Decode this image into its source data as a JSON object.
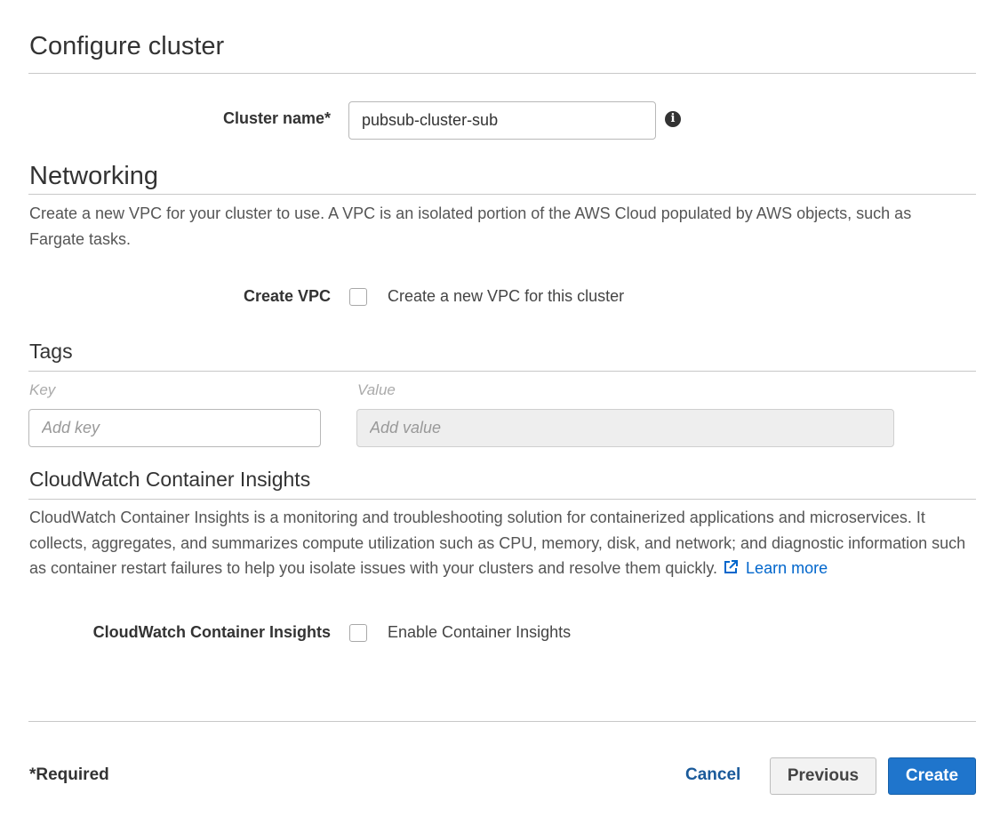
{
  "configure": {
    "title": "Configure cluster"
  },
  "cluster_name": {
    "label": "Cluster name*",
    "value": "pubsub-cluster-sub",
    "info_icon": "info-icon"
  },
  "networking": {
    "title": "Networking",
    "description": "Create a new VPC for your cluster to use. A VPC is an isolated portion of the AWS Cloud populated by AWS objects, such as Fargate tasks.",
    "create_vpc_label": "Create VPC",
    "create_vpc_checkbox_text": "Create a new VPC for this cluster",
    "create_vpc_checked": false
  },
  "tags": {
    "title": "Tags",
    "key_header": "Key",
    "value_header": "Value",
    "key_placeholder": "Add key",
    "value_placeholder": "Add value"
  },
  "insights": {
    "title": "CloudWatch Container Insights",
    "description": "CloudWatch Container Insights is a monitoring and troubleshooting solution for containerized applications and microservices. It collects, aggregates, and summarizes compute utilization such as CPU, memory, disk, and network; and diagnostic information such as container restart failures to help you isolate issues with your clusters and resolve them quickly.",
    "learn_more": "Learn more",
    "learn_more_icon": "external-link-icon",
    "field_label": "CloudWatch Container Insights",
    "checkbox_text": "Enable Container Insights",
    "checked": false
  },
  "footer": {
    "required_note": "*Required",
    "cancel": "Cancel",
    "previous": "Previous",
    "create": "Create"
  },
  "colors": {
    "primary": "#1f75cc",
    "link": "#0066cc",
    "rule": "#c8c8c8"
  }
}
